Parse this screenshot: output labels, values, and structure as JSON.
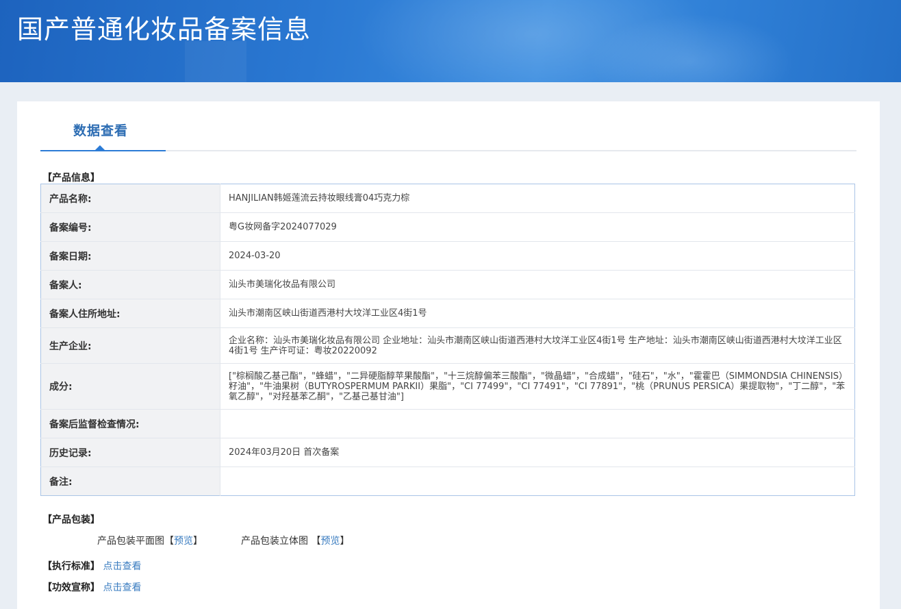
{
  "header": {
    "title": "国产普通化妆品备案信息"
  },
  "tab": {
    "label": "数据查看"
  },
  "product_section": {
    "title": "【产品信息】",
    "rows": [
      {
        "label": "产品名称:",
        "value": "HANJILIAN韩姬莲流云持妆眼线膏04巧克力棕"
      },
      {
        "label": "备案编号:",
        "value": "粤G妆网备字2024077029"
      },
      {
        "label": "备案日期:",
        "value": "2024-03-20"
      },
      {
        "label": "备案人:",
        "value": "汕头市美瑞化妆品有限公司"
      },
      {
        "label": "备案人住所地址:",
        "value": "汕头市潮南区峡山街道西港村大坟洋工业区4街1号"
      },
      {
        "label": "生产企业:",
        "value": "企业名称：汕头市美瑞化妆品有限公司 企业地址：汕头市潮南区峡山街道西港村大坟洋工业区4街1号 生产地址：汕头市潮南区峡山街道西港村大坟洋工业区4街1号 生产许可证：粤妆20220092"
      },
      {
        "label": "成分:",
        "value": "[\"棕榈酸乙基己酯\"，\"蜂蜡\"，\"二异硬脂醇苹果酸酯\"，\"十三烷醇偏苯三酸酯\"，\"微晶蜡\"，\"合成蜡\"，\"硅石\"，\"水\"，\"霍霍巴（SIMMONDSIA CHINENSIS）籽油\"，\"牛油果树（BUTYROSPERMUM PARKII）果脂\"，\"CI 77499\"，\"CI 77491\"，\"CI 77891\"，\"桃（PRUNUS PERSICA）果提取物\"，\"丁二醇\"，\"苯氧乙醇\"，\"对羟基苯乙酮\"，\"乙基己基甘油\"]"
      },
      {
        "label": "备案后监督检查情况:",
        "value": ""
      },
      {
        "label": "历史记录:",
        "value": "2024年03月20日 首次备案"
      },
      {
        "label": "备注:",
        "value": ""
      }
    ]
  },
  "packaging": {
    "title": "【产品包装】",
    "flat_label": "产品包装平面图",
    "stereo_label": "产品包装立体图",
    "bracket_open": "【",
    "bracket_close": "】",
    "preview_link": "预览"
  },
  "standard": {
    "title": "【执行标准】",
    "link": "点击查看"
  },
  "efficacy": {
    "title": "【功效宣称】",
    "link": "点击查看"
  }
}
